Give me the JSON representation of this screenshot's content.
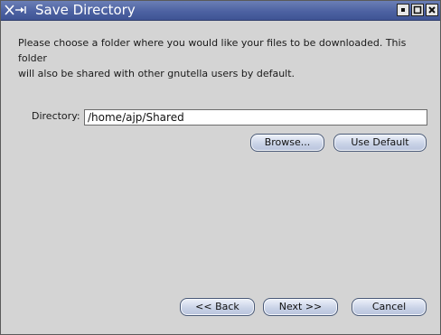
{
  "window": {
    "title": "Save Directory",
    "icon": "x-arrow-icon",
    "controls": {
      "minimize": "minimize-icon",
      "maximize": "maximize-icon",
      "close": "close-icon"
    }
  },
  "content": {
    "instructions_line1": "Please choose a folder where you would like your files to be downloaded. This folder",
    "instructions_line2": "will also be shared with other gnutella users by default.",
    "directory_label": "Directory:",
    "directory_value": "/home/ajp/Shared",
    "browse_label": "Browse...",
    "use_default_label": "Use Default"
  },
  "footer": {
    "back_label": "<< Back",
    "next_label": "Next >>",
    "cancel_label": "Cancel"
  },
  "colors": {
    "titlebar": "#4d62a2",
    "window_bg": "#d4d4d4",
    "button_bg": "#c7d1e6",
    "button_border": "#4a5a78"
  }
}
